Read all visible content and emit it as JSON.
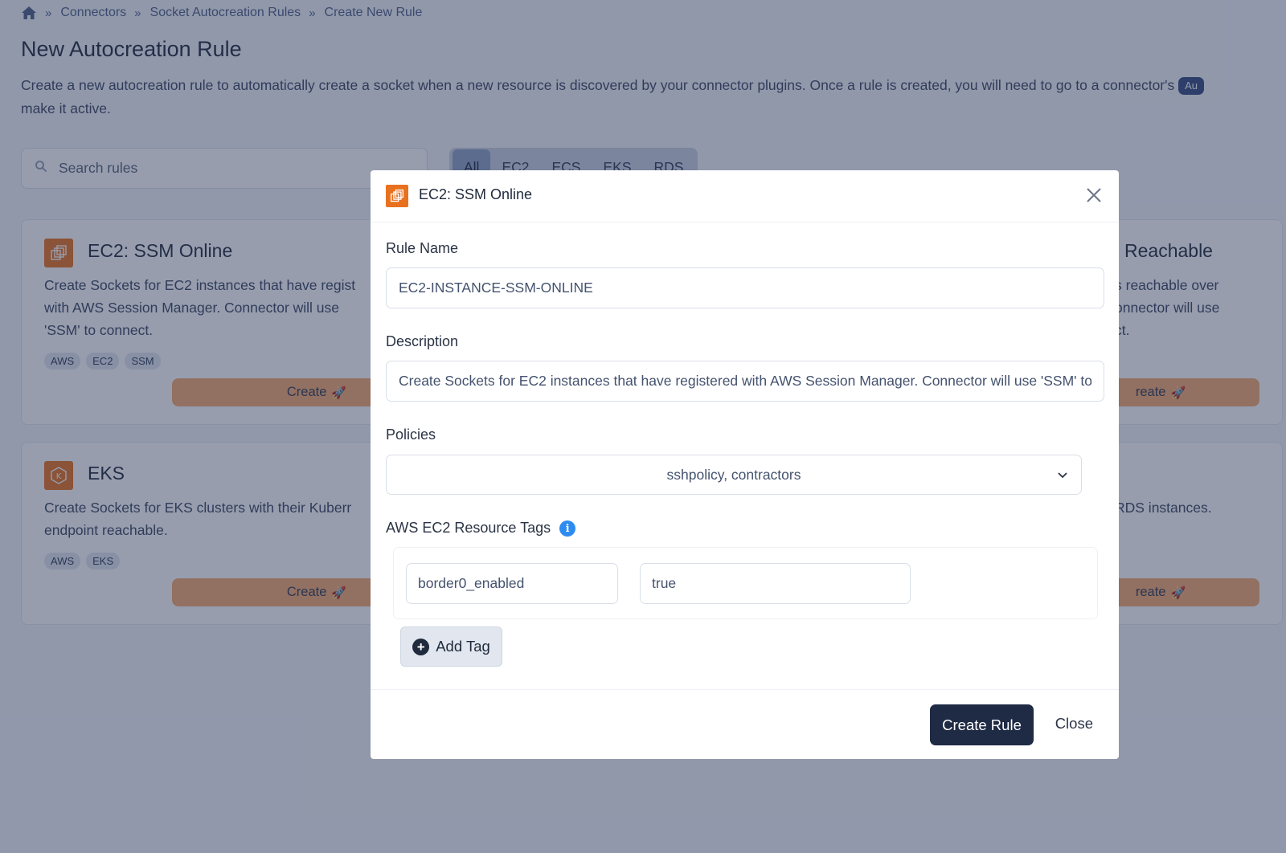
{
  "breadcrumb": {
    "home_icon": "home-icon",
    "items": [
      "Connectors",
      "Socket Autocreation Rules",
      "Create New Rule"
    ],
    "separator": "»"
  },
  "page": {
    "title": "New Autocreation Rule",
    "description_part1": "Create a new autocreation rule to automatically create a socket when a new resource is discovered by your connector plugins. Once a rule is created, you will need to go to a connector's",
    "description_pill": "Au",
    "description_part2": "make it active."
  },
  "search": {
    "placeholder": "Search rules",
    "icon": "search-icon"
  },
  "filter_tabs": [
    {
      "label": "All",
      "active": true
    },
    {
      "label": "EC2",
      "active": false
    },
    {
      "label": "ECS",
      "active": false
    },
    {
      "label": "EKS",
      "active": false
    },
    {
      "label": "RDS",
      "active": false
    }
  ],
  "cards": {
    "ec2_ssm": {
      "title": "EC2: SSM Online",
      "desc1": "Create Sockets for EC2 instances that have regist",
      "desc2": "with AWS Session Manager. Connector will use",
      "desc3": "'SSM' to connect.",
      "tags": [
        "AWS",
        "EC2",
        "SSM"
      ],
      "button": "Create",
      "icon": "ec2-icon"
    },
    "reachable": {
      "title": "Reachable",
      "desc1": "s reachable over",
      "desc2": "onnector will use",
      "desc3": "ct.",
      "button": "Create",
      "button_partial": "reate"
    },
    "eks": {
      "title": "EKS",
      "desc1": "Create Sockets for EKS clusters with their Kuberr",
      "desc2": "endpoint reachable.",
      "tags": [
        "AWS",
        "EKS"
      ],
      "button": "Create",
      "icon": "eks-icon"
    },
    "rds": {
      "desc1": "RDS instances.",
      "button_partial": "reate"
    }
  },
  "modal": {
    "title": "EC2: SSM Online",
    "icon": "ec2-icon",
    "rule_name_label": "Rule Name",
    "rule_name_value": "EC2-INSTANCE-SSM-ONLINE",
    "description_label": "Description",
    "description_value": "Create Sockets for EC2 instances that have registered with AWS Session Manager. Connector will use 'SSM' to connect.",
    "policies_label": "Policies",
    "policies_value": "sshpolicy, contractors",
    "resource_tags_label": "AWS EC2 Resource Tags",
    "tag_key": "border0_enabled",
    "tag_value": "true",
    "add_tag_label": "Add Tag",
    "create_rule_label": "Create Rule",
    "close_label": "Close"
  },
  "colors": {
    "accent_orange": "#e8711f",
    "create_button": "#f6ab6f",
    "primary_dark": "#1f2a44",
    "info_blue": "#2e8cf0"
  }
}
